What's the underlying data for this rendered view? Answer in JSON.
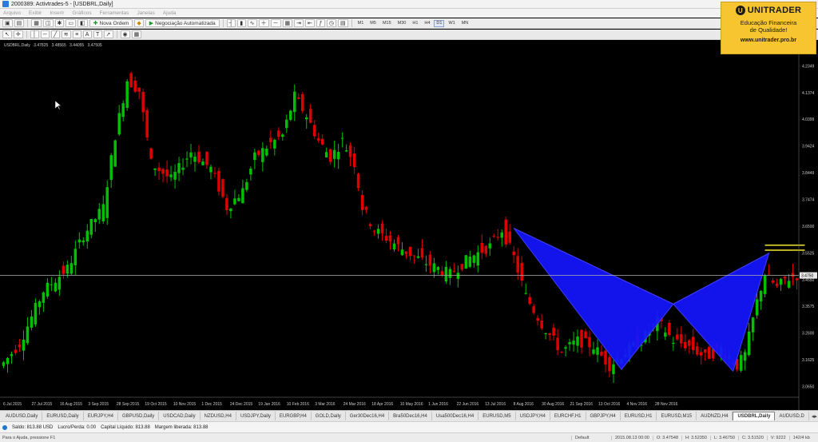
{
  "window": {
    "title": "2000389: Activtrades-5 - [USDBRL,Daily]"
  },
  "menu": [
    "Arquivo",
    "Exibir",
    "Inserir",
    "Gráficos",
    "Ferramentas",
    "Janelas",
    "Ajuda"
  ],
  "toolbar": {
    "new_order": "Nova Ordem",
    "auto_trading": "Negociação Automatizada",
    "timeframes": [
      "M1",
      "M5",
      "M15",
      "M30",
      "H1",
      "H4",
      "D1",
      "W1",
      "MN"
    ],
    "active_timeframe": "D1"
  },
  "chart": {
    "symbol_header": "USDBRL,Daily",
    "ohlc": [
      "3.47825",
      "3.48565",
      "3.44055",
      "3.47505"
    ]
  },
  "chart_data": {
    "type": "candlestick",
    "symbol": "USDBRL",
    "timeframe": "Daily",
    "x_labels": [
      "6 Jul 2015",
      "27 Jul 2015",
      "16 Aug 2015",
      "3 Sep 2015",
      "28 Sep 2015",
      "19 Oct 2015",
      "10 Nov 2015",
      "1 Dec 2015",
      "24 Dec 2015",
      "19 Jan 2016",
      "10 Feb 2016",
      "3 Mar 2016",
      "24 Mar 2016",
      "18 Apr 2016",
      "10 May 2016",
      "1 Jun 2016",
      "22 Jun 2016",
      "13 Jul 2016",
      "8 Aug 2016",
      "30 Aug 2016",
      "21 Sep 2016",
      "13 Oct 2016",
      "4 Nov 2016",
      "28 Nov 2016"
    ],
    "y_labels": [
      "4.2349",
      "4.1374",
      "4.0399",
      "3.9424",
      "3.8449",
      "3.7474",
      "3.6500",
      "3.5525",
      "3.4550",
      "3.3575",
      "3.2600",
      "3.1625",
      "3.0650"
    ],
    "y_range": [
      3.065,
      4.28
    ],
    "current_price": "3.4750",
    "current_price_line": 3.475,
    "close_anchor_path": [
      [
        0,
        3.16
      ],
      [
        4,
        3.23
      ],
      [
        10,
        3.42
      ],
      [
        16,
        3.5
      ],
      [
        20,
        3.62
      ],
      [
        25,
        3.72
      ],
      [
        28,
        3.98
      ],
      [
        31,
        4.18
      ],
      [
        34,
        4.14
      ],
      [
        37,
        3.88
      ],
      [
        42,
        3.82
      ],
      [
        47,
        3.92
      ],
      [
        52,
        3.86
      ],
      [
        56,
        3.72
      ],
      [
        60,
        3.78
      ],
      [
        63,
        3.9
      ],
      [
        67,
        3.95
      ],
      [
        70,
        3.98
      ],
      [
        73,
        4.12
      ],
      [
        76,
        4.05
      ],
      [
        79,
        3.96
      ],
      [
        82,
        3.9
      ],
      [
        85,
        3.96
      ],
      [
        88,
        3.88
      ],
      [
        90,
        3.72
      ],
      [
        93,
        3.64
      ],
      [
        97,
        3.6
      ],
      [
        101,
        3.56
      ],
      [
        106,
        3.52
      ],
      [
        112,
        3.48
      ],
      [
        117,
        3.54
      ],
      [
        122,
        3.58
      ],
      [
        125,
        3.64
      ],
      [
        128,
        3.54
      ],
      [
        131,
        3.4
      ],
      [
        135,
        3.3
      ],
      [
        140,
        3.2
      ],
      [
        144,
        3.24
      ],
      [
        148,
        3.22
      ],
      [
        152,
        3.15
      ],
      [
        156,
        3.2
      ],
      [
        160,
        3.24
      ],
      [
        164,
        3.31
      ],
      [
        168,
        3.24
      ],
      [
        172,
        3.22
      ],
      [
        176,
        3.18
      ],
      [
        180,
        3.21
      ],
      [
        184,
        3.15
      ],
      [
        186,
        3.19
      ],
      [
        189,
        3.38
      ],
      [
        191,
        3.48
      ],
      [
        194,
        3.43
      ],
      [
        196,
        3.46
      ],
      [
        199,
        3.475
      ]
    ],
    "harmonic_pattern": {
      "type": "Bat",
      "points": [
        {
          "date": "1 Jun 2016",
          "price": 3.645
        },
        {
          "date": "8 Aug 2016",
          "price": 3.136
        },
        {
          "date": "30 Aug 2016",
          "price": 3.372
        },
        {
          "date": "13 Oct 2016",
          "price": 3.13
        },
        {
          "date": "4 Nov 2016",
          "price": 3.555
        }
      ],
      "fill_color": "#1515ff"
    },
    "horizontal_levels": [
      3.584,
      3.566
    ],
    "level_color": "#f2e62b",
    "colors": {
      "background": "#000000",
      "bull_candle": "#00c000",
      "bear_candle": "#e00000"
    }
  },
  "brand": {
    "logo_text": "UNITRADER",
    "tagline_line1": "Educação Financeira",
    "tagline_line2": "de Qualidade!",
    "url": "www.unitrader.pro.br",
    "color": "#f6c52f"
  },
  "symbol_tabs": [
    "AUDUSD,Daily",
    "EURUSD,Daily",
    "EURJPY,H4",
    "GBPUSD,Daily",
    "USDCAD,Daily",
    "NZDUSD,H4",
    "USDJPY,Daily",
    "EURGBP,H4",
    "GOLD,Daily",
    "Ger30Dec16,H4",
    "Bra50Dec16,H4",
    "Usa500Dec16,H4",
    "EURUSD,M5",
    "USDJPY,H4",
    "EURCHF,H1",
    "GBPJPY,H4",
    "EURUSD,H1",
    "EURUSD,M15",
    "AUDNZD,H4",
    "USDBRL,Daily",
    "AUDUSD,D"
  ],
  "active_tab": "USDBRL,Daily",
  "account": {
    "saldo": "Saldo: 813.88 USD",
    "lucro": "Lucro/Perda: 0.00",
    "capital": "Capital Líquido: 813.88",
    "margem": "Margem liberada: 813.88"
  },
  "status": {
    "help": "Para o Ajuda, pressione F1",
    "profile": "Default",
    "datetime": "2015.08.13 00:00",
    "open": "O: 3.47548",
    "high": "H: 3.52350",
    "low": "L: 3.46750",
    "close": "C: 3.51520",
    "volume": "V: 9222",
    "traffic": "142/4 kb"
  }
}
